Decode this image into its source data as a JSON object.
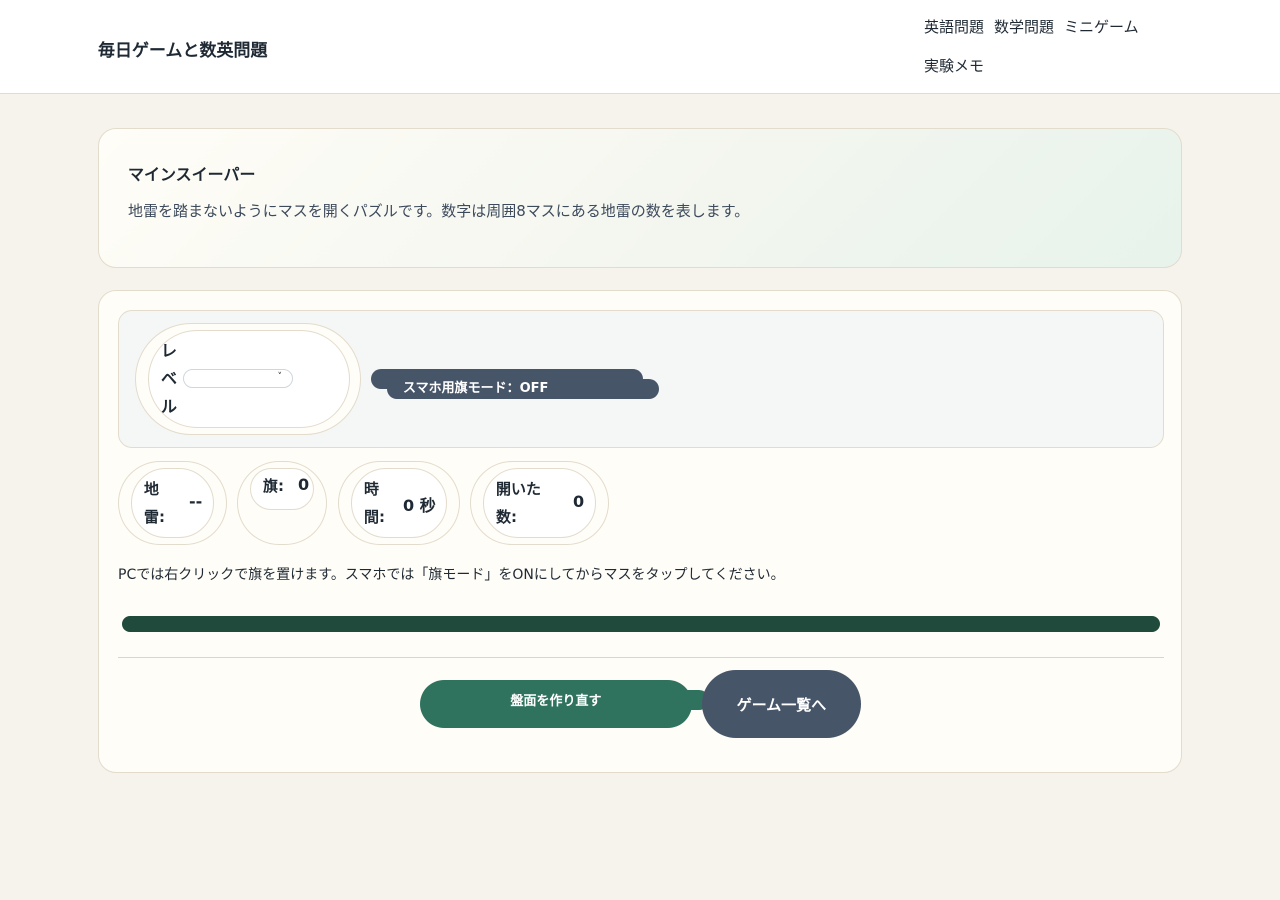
{
  "header": {
    "brand": "毎日ゲームと数英問題",
    "nav": [
      "英語問題",
      "数学問題",
      "ミニゲーム",
      "実験メモ"
    ]
  },
  "intro": {
    "title": "マインスイーパー",
    "description": "地雷を踏まないようにマスを開くパズルです。数字は周囲8マスにある地雷の数を表します。"
  },
  "controls": {
    "level_label": [
      "レ",
      "ベ",
      "ル"
    ],
    "level_value": "",
    "flag_mode_button": "スマホ用旗モード：OFF"
  },
  "stats": {
    "mines_label": [
      "地",
      "雷:"
    ],
    "mines_value": "--",
    "flags_label": "旗:",
    "flags_value": "0",
    "time_label": [
      "時",
      "間:"
    ],
    "time_value": "0 秒",
    "opened_label": [
      "開いた",
      "数:"
    ],
    "opened_value": "0"
  },
  "hint": "PCでは右クリックで旗を置けます。スマホでは「旗モード」をONにしてからマスをタップしてください。",
  "actions": {
    "reset_button": "盤面を作り直す",
    "games_list_button": "ゲーム一覧へ"
  },
  "colors": {
    "page_bg": "#f6f3ec",
    "accent_green": "#2f735e",
    "board_dark": "#1f4a3c",
    "slate_button": "#475569"
  }
}
